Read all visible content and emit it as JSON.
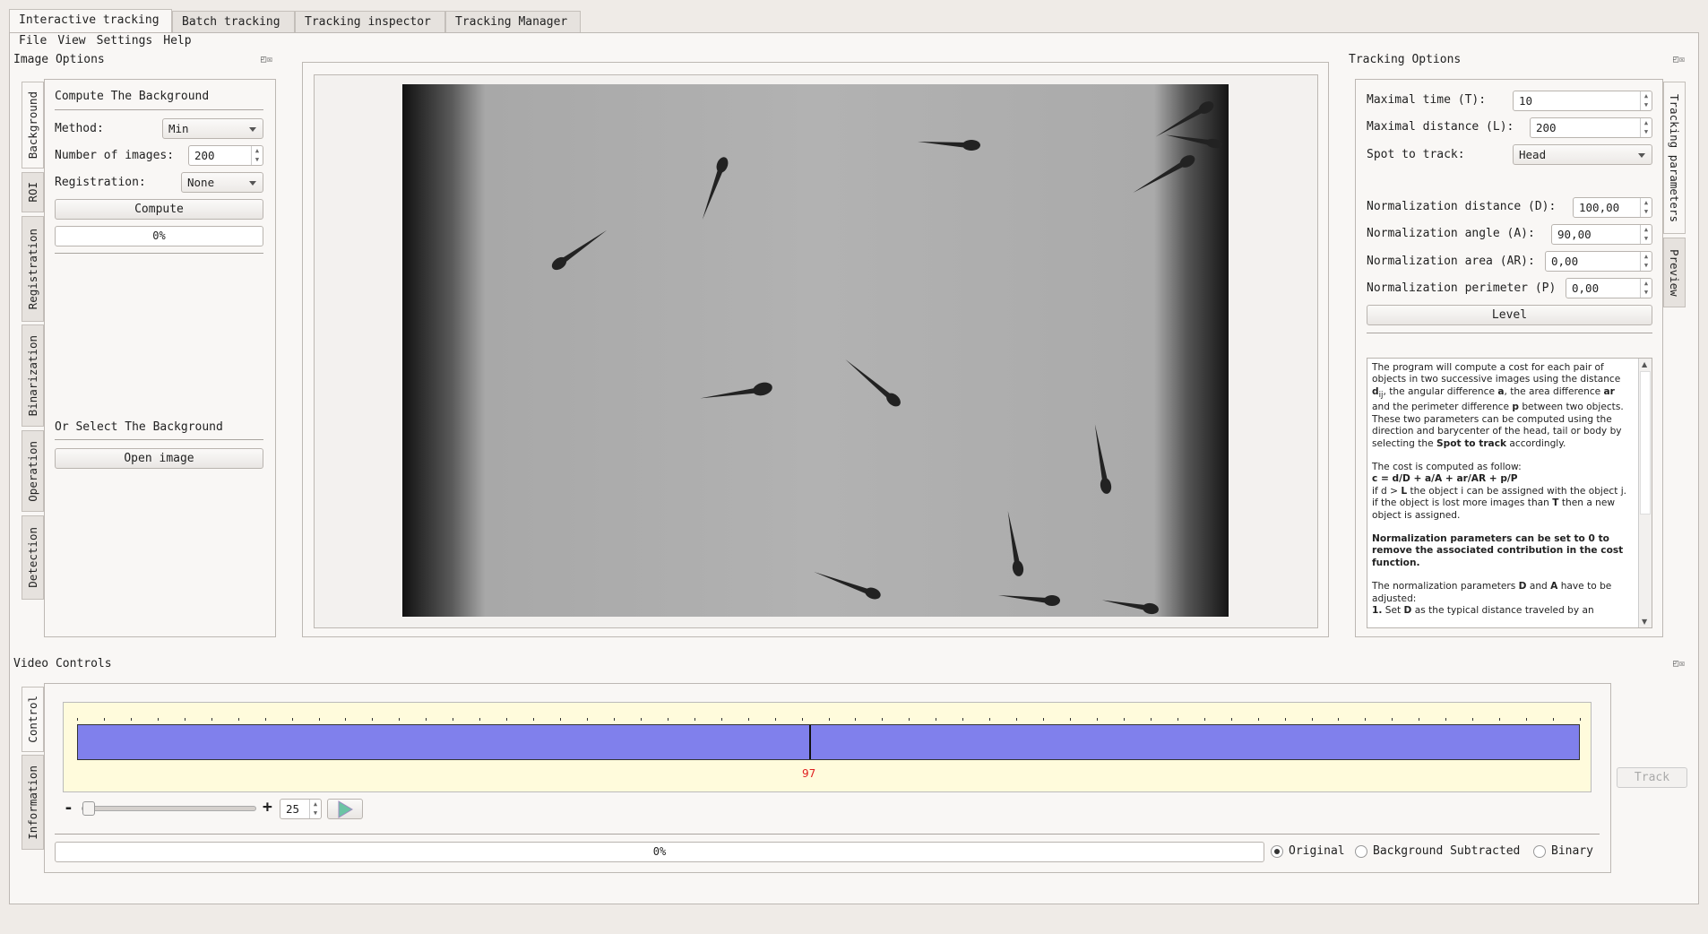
{
  "tabs": [
    "Interactive tracking",
    "Batch tracking",
    "Tracking inspector",
    "Tracking Manager"
  ],
  "menu": [
    "File",
    "View",
    "Settings",
    "Help"
  ],
  "image_options": {
    "title": "Image Options",
    "vtabs": [
      "Background",
      "ROI",
      "Registration",
      "Binarization",
      "Operation",
      "Detection"
    ],
    "compute_heading": "Compute The Background",
    "method_label": "Method:",
    "method_value": "Min",
    "num_images_label": "Number of images:",
    "num_images_value": "200",
    "registration_label": "Registration:",
    "registration_value": "None",
    "compute_button": "Compute",
    "progress": "0%",
    "select_heading": "Or Select The Background",
    "open_button": "Open image"
  },
  "tracking_options": {
    "title": "Tracking Options",
    "vtabs": [
      "Tracking parameters",
      "Preview"
    ],
    "max_time_label": "Maximal time (T):",
    "max_time": "10",
    "max_dist_label": "Maximal distance (L):",
    "max_dist": "200",
    "spot_label": "Spot to track:",
    "spot": "Head",
    "norm_dist_label": "Normalization distance (D):",
    "norm_dist": "100,00",
    "norm_angle_label": "Normalization angle (A):",
    "norm_angle": "90,00",
    "norm_area_label": "Normalization area (AR):",
    "norm_area": "0,00",
    "norm_perim_label": "Normalization perimeter (P)",
    "norm_perim": "0,00",
    "level_button": "Level",
    "help": {
      "p1a": "The program will compute a cost for each pair of objects in two successive images using the distance ",
      "d": "d",
      "ij": "ij",
      "p1b": ", the angular difference ",
      "a": "a",
      "p1c": ", the area difference ",
      "ar": "ar",
      "p1d": " and the perimeter difference ",
      "p": "p",
      "p1e": " between two objects. These two parameters can be computed using the direction and barycenter of the head, tail or body by selecting the ",
      "spot": "Spot to track",
      "p1f": " accordingly.",
      "p2": "The cost is computed as follow:",
      "formula": "c = d/D + a/A +  ar/AR +  p/P",
      "p3a": "if d > ",
      "L": "L",
      "p3b": " the object i can be assigned with the object j.",
      "p4a": "if the object is lost more images than ",
      "T": "T",
      "p4b": " then a new object is assigned.",
      "p5": "Normalization parameters can be set to 0 to remove the associated contribution in the cost function.",
      "p6a": "The normalization parameters ",
      "D": "D",
      "p6b": " and ",
      "A": "A",
      "p6c": " have to be adjusted:",
      "p7a": "1.",
      "p7b": " Set ",
      "p7c": " as the typical distance traveled by an"
    }
  },
  "video_controls": {
    "title": "Video Controls",
    "vtabs": [
      "Control",
      "Information"
    ],
    "current_frame": "97",
    "frame_fraction": 0.487,
    "minus": "-",
    "plus": "+",
    "fps": "25",
    "speed_fraction": 0.0,
    "progress": "0%",
    "radios": [
      "Original",
      "Background Subtracted",
      "Binary"
    ],
    "selected_radio": "Original",
    "track_button": "Track"
  },
  "colors": {
    "timeline_bar": "#8080ec",
    "timeline_bg": "#fffbdc",
    "frame_label": "#e02020"
  }
}
